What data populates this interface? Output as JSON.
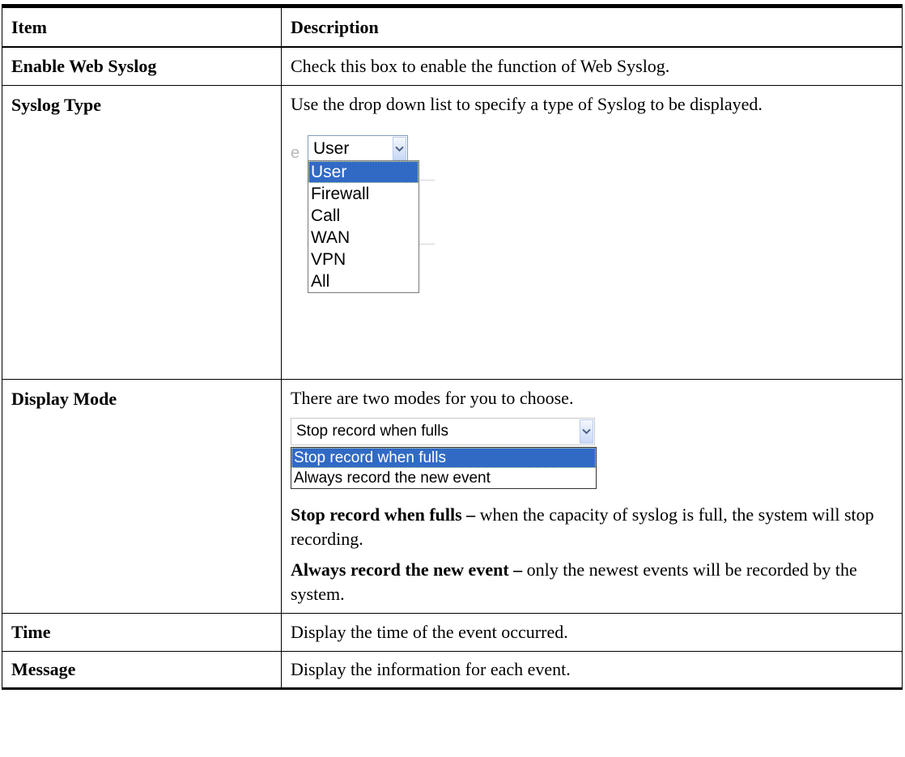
{
  "table": {
    "headers": {
      "item": "Item",
      "description": "Description"
    },
    "rows": [
      {
        "item": "Enable Web Syslog",
        "description": "Check this box to enable the function of Web Syslog."
      },
      {
        "item": "Syslog Type",
        "description": "Use the drop down list to specify a type of Syslog to be displayed.",
        "dropdown": {
          "ghost_char": "e",
          "selected": "User",
          "options": [
            "User",
            "Firewall",
            "Call",
            "WAN",
            "VPN",
            "All"
          ],
          "highlighted_index": 0
        }
      },
      {
        "item": "Display Mode",
        "description": "There are two modes for you to choose.",
        "dropdown": {
          "selected": "Stop record when fulls",
          "options": [
            "Stop record when fulls",
            "Always record the new event"
          ],
          "highlighted_index": 0
        },
        "notes": [
          {
            "term": "Stop record when fulls –",
            "text": " when the capacity of syslog is full, the system will stop recording."
          },
          {
            "term": "Always record the new event –",
            "text": " only the newest events will be recorded by the system."
          }
        ]
      },
      {
        "item": "Time",
        "description": "Display the time of the event occurred."
      },
      {
        "item": "Message",
        "description": "Display the information for each event."
      }
    ]
  },
  "colors": {
    "selection": "#316ac5",
    "combo_border": "#7f9db9"
  }
}
